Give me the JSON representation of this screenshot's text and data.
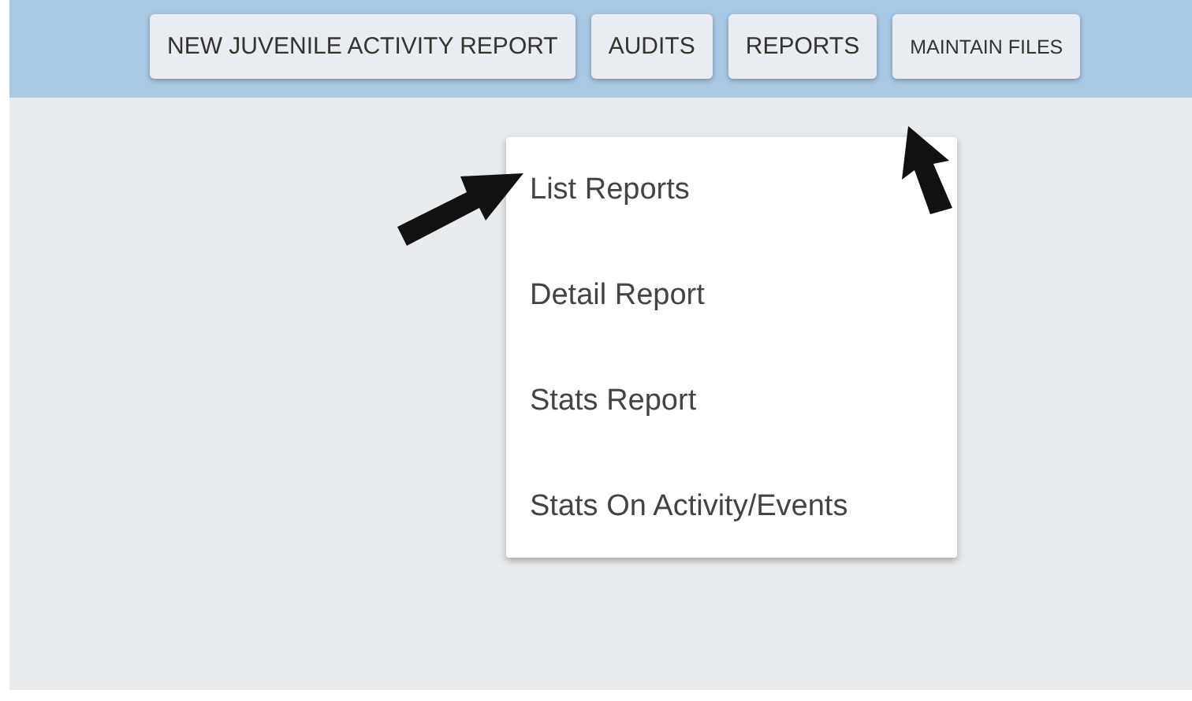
{
  "nav_buttons": [
    {
      "label": "NEW JUVENILE ACTIVITY REPORT",
      "kind": "regular"
    },
    {
      "label": "AUDITS",
      "kind": "regular"
    },
    {
      "label": "REPORTS",
      "kind": "regular"
    },
    {
      "label": "MAINTAIN FILES",
      "kind": "compact"
    }
  ],
  "dropdown_menu": {
    "items": [
      "List Reports",
      "Detail Report",
      "Stats Report",
      "Stats On Activity/Events"
    ]
  }
}
